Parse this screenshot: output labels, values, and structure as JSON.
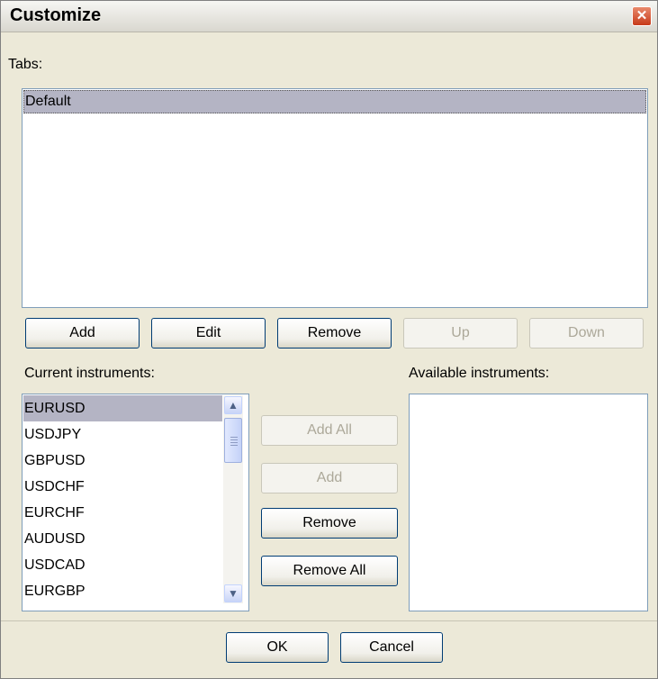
{
  "window": {
    "title": "Customize"
  },
  "tabs": {
    "label": "Tabs:",
    "items": [
      "Default"
    ],
    "buttons": {
      "add": "Add",
      "edit": "Edit",
      "remove": "Remove",
      "up": "Up",
      "down": "Down"
    }
  },
  "current": {
    "label": "Current instruments:",
    "items": [
      "EURUSD",
      "USDJPY",
      "GBPUSD",
      "USDCHF",
      "EURCHF",
      "AUDUSD",
      "USDCAD",
      "EURGBP"
    ],
    "selected": "EURUSD"
  },
  "available": {
    "label": "Available instruments:",
    "items": []
  },
  "transfer": {
    "add_all": "Add All",
    "add": "Add",
    "remove": "Remove",
    "remove_all": "Remove All"
  },
  "footer": {
    "ok": "OK",
    "cancel": "Cancel"
  },
  "icons": {
    "close": "close-icon",
    "scroll_up": "chevron-up-icon",
    "scroll_down": "chevron-down-icon"
  }
}
